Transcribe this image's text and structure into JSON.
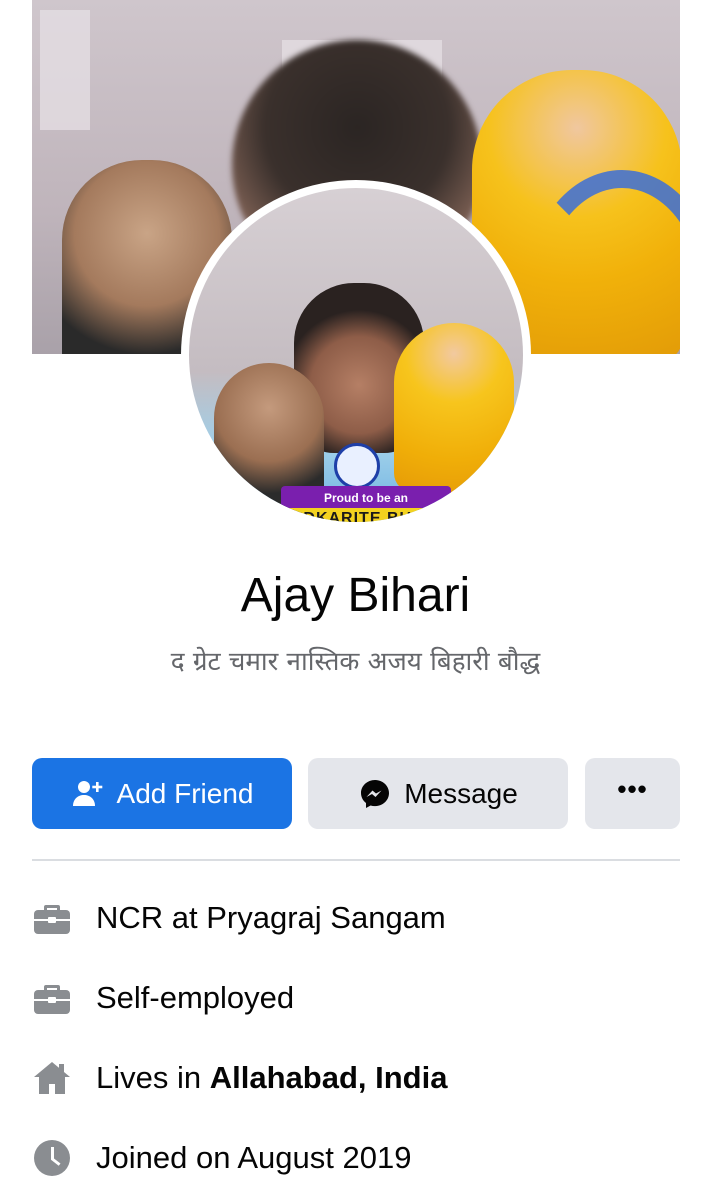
{
  "profile": {
    "name": "Ajay Bihari",
    "bio": "द ग्रेट चमार नास्तिक अजय बिहारी बौद्ध",
    "avatar_banner_top": "Proud to be an",
    "avatar_banner_bottom": "DKARITE BUD"
  },
  "actions": {
    "add_friend_label": "Add Friend",
    "message_label": "Message",
    "more_label": "•••"
  },
  "details": {
    "work_1": "NCR at Pryagraj Sangam",
    "work_2": "Self-employed",
    "lives_prefix": "Lives in ",
    "lives_place": "Allahabad, India",
    "joined": "Joined on August 2019"
  },
  "icons": {
    "add_friend": "add-person-icon",
    "message": "messenger-icon",
    "work": "briefcase-icon",
    "home": "home-icon",
    "clock": "clock-icon"
  },
  "colors": {
    "primary": "#1b74e4",
    "secondary_button": "#e4e6eb",
    "secondary_text": "#65676b",
    "icon_gray": "#8a8d91"
  }
}
